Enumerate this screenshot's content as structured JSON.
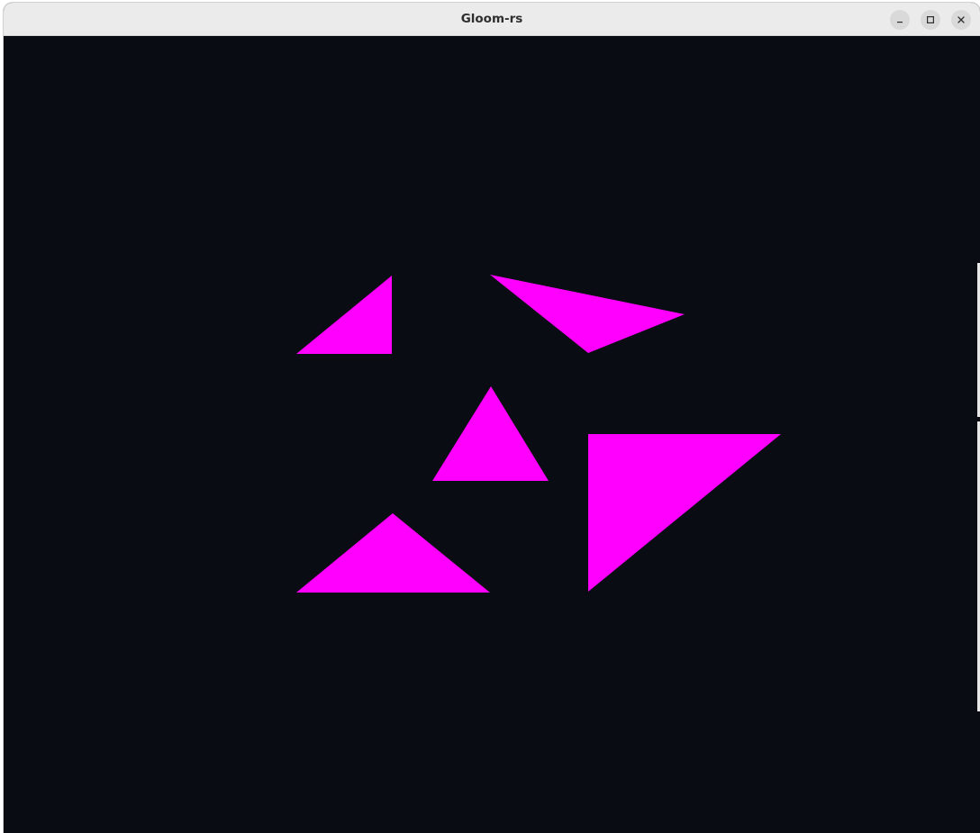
{
  "window": {
    "title": "Gloom-rs"
  },
  "controls": {
    "minimize_icon": "minimize-icon",
    "maximize_icon": "maximize-icon",
    "close_icon": "close-icon"
  },
  "scene": {
    "background_color": "#0a0c14",
    "triangle_color": "#ff00ff",
    "triangle_count": 5
  }
}
